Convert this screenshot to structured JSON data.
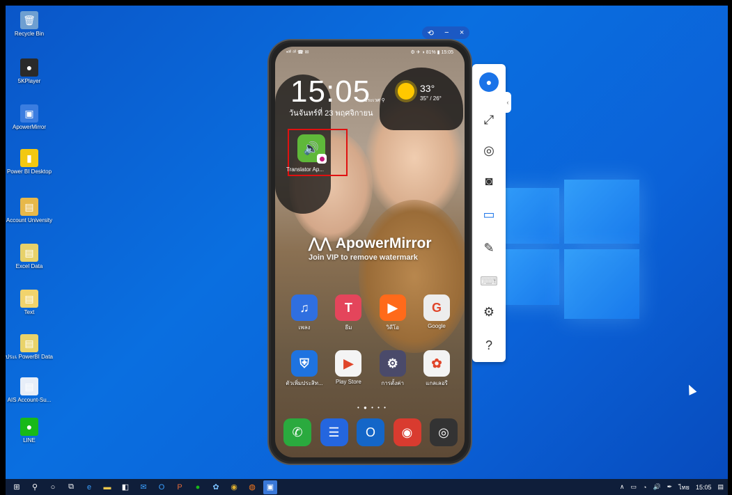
{
  "desktop": {
    "icons": [
      {
        "label": "Recycle Bin",
        "glyph": "🗑",
        "color": "#6e9fd1"
      },
      {
        "label": "5KPlayer",
        "glyph": "●",
        "color": "#2a2a2a"
      },
      {
        "label": "ApowerMirror",
        "glyph": "▣",
        "color": "#3b7de0"
      },
      {
        "label": "Power BI Desktop",
        "glyph": "▮",
        "color": "#f2c811"
      },
      {
        "label": "Account University",
        "glyph": "▤",
        "color": "#e7b84a"
      },
      {
        "label": "Excel Data",
        "glyph": "▤",
        "color": "#e7d16a"
      },
      {
        "label": "Text",
        "glyph": "▤",
        "color": "#f1d36c"
      },
      {
        "label": "ประเ PowerBI Data",
        "glyph": "▤",
        "color": "#e9d36a"
      },
      {
        "label": "AIS Account-Su...",
        "glyph": "▤",
        "color": "#e7eef8"
      },
      {
        "label": "LINE",
        "glyph": "●",
        "color": "#18b918"
      }
    ]
  },
  "window_controls": {
    "pin": "⟲",
    "minimize": "−",
    "close": "×"
  },
  "phone": {
    "status_left": "•ᵃˡˡ ᵃˡˡ ☎ ✉",
    "status_right": "⚙ ✈ ◑ 81% ▮ 15:05",
    "clock": "15:05",
    "date": "วันจันทร์ที่ 23 พฤศจิกายน",
    "location": "ประเวศ ⚲",
    "weather": {
      "temp": "33°",
      "range": "35° / 26°"
    },
    "translator_app": {
      "label": "Translator Ap...",
      "icon": "speaker-icon"
    },
    "watermark": {
      "brand": "ApowerMirror",
      "sub": "Join VIP to remove watermark"
    },
    "row1": [
      {
        "name": "เพลง",
        "glyph": "♫",
        "color": "#2f6fe0"
      },
      {
        "name": "ธีม",
        "glyph": "T",
        "color": "#e4455b"
      },
      {
        "name": "วิดีโอ",
        "glyph": "▶",
        "color": "#ff6a1a"
      },
      {
        "name": "Google",
        "glyph": "G",
        "color": "#ededed"
      }
    ],
    "row2": [
      {
        "name": "ตัวเพิ่มประสิท...",
        "glyph": "⛨",
        "color": "#1e73e0"
      },
      {
        "name": "Play Store",
        "glyph": "▶",
        "color": "#f4f4f4"
      },
      {
        "name": "การตั้งค่า",
        "glyph": "⚙",
        "color": "#4a4a6a"
      },
      {
        "name": "แกลเลอรี",
        "glyph": "✿",
        "color": "#f3f3f3"
      }
    ],
    "page_dots": "• ● • • •",
    "dock": [
      {
        "name": "phone",
        "glyph": "✆",
        "color": "#2aaa3e"
      },
      {
        "name": "messages",
        "glyph": "☰",
        "color": "#2466df"
      },
      {
        "name": "outlook",
        "glyph": "O",
        "color": "#1466c8"
      },
      {
        "name": "chrome",
        "glyph": "◉",
        "color": "#d93b2f"
      },
      {
        "name": "camera",
        "glyph": "◎",
        "color": "#333333"
      }
    ]
  },
  "toolbar": {
    "items": [
      "avatar-icon",
      "fullscreen-icon",
      "screenshot-icon",
      "record-icon",
      "cast-icon",
      "whiteboard-icon",
      "keyboard-icon",
      "settings-icon",
      "help-icon"
    ],
    "glyphs": [
      "●",
      "⤢",
      "◎",
      "◙",
      "▭",
      "✎",
      "⌨",
      "⚙",
      "?"
    ]
  },
  "taskbar": {
    "clock": "15:05",
    "language": "ไทย"
  }
}
